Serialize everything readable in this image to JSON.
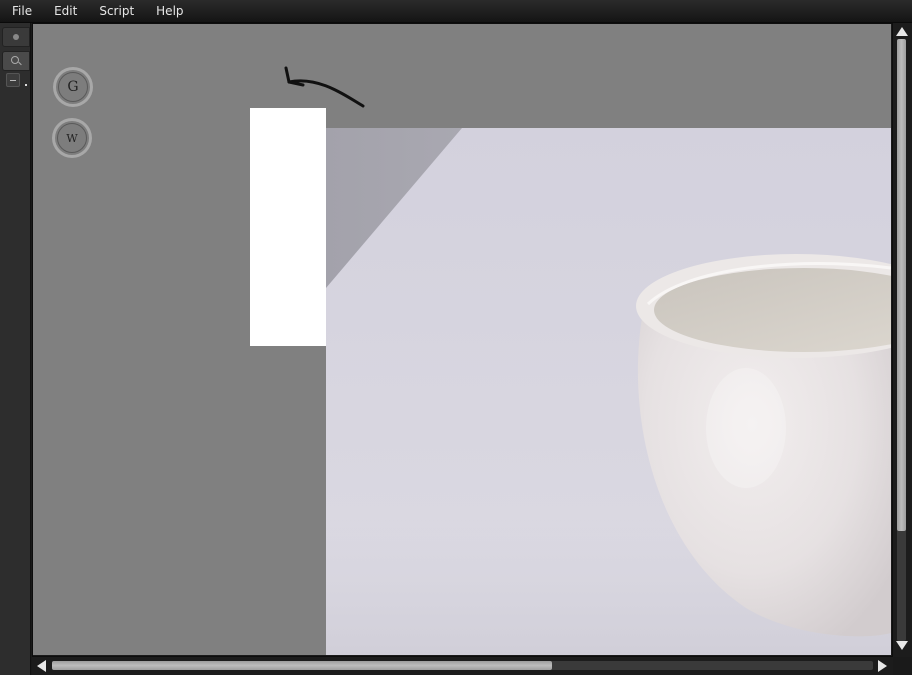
{
  "menu": {
    "file": "File",
    "edit": "Edit",
    "script": "Script",
    "help": "Help"
  },
  "tools": {
    "g_label": "G",
    "w_label": "W"
  },
  "icons": {
    "zoom": "zoom-icon",
    "annotation": "curved-arrow-icon"
  },
  "colors": {
    "canvas_bg": "#808080",
    "chrome": "#1a1a1a",
    "annotation": "#111111"
  },
  "scroll": {
    "vertical_position": 0.0,
    "horizontal_position": 0.0
  }
}
